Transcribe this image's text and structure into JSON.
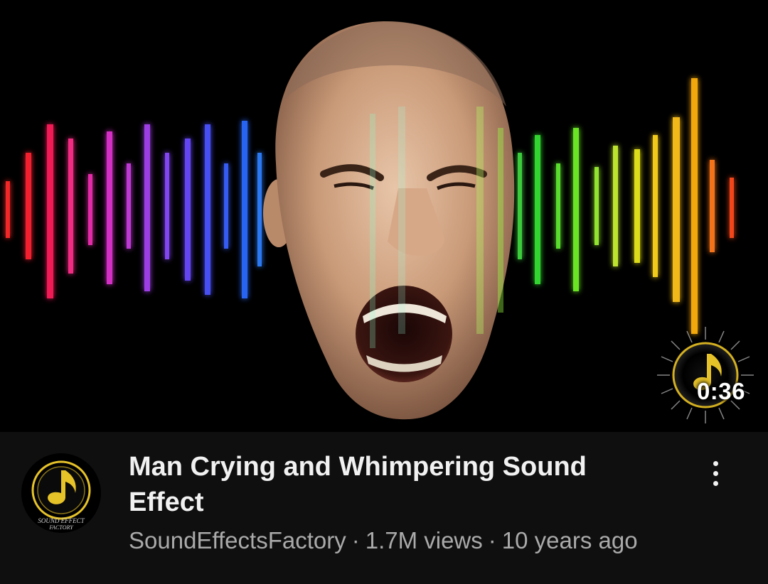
{
  "video": {
    "title": "Man Crying and Whimpering Sound Effect",
    "duration": "0:36",
    "channel": "SoundEffectsFactory",
    "views": "1.7M views",
    "age": "10 years ago",
    "separator": "·"
  },
  "avatar": {
    "logo_text_line1": "SOUND EFFECT",
    "logo_text_line2": "FACTORY"
  },
  "icons": {
    "more": "more-vert-icon",
    "avatar": "channel-logo-music-note-icon",
    "watermark": "music-note-watermark-icon"
  },
  "colors": {
    "background": "#0f0f0f",
    "title": "#f1f1f1",
    "meta": "#aaaaaa",
    "logo_gold": "#e6c229"
  }
}
